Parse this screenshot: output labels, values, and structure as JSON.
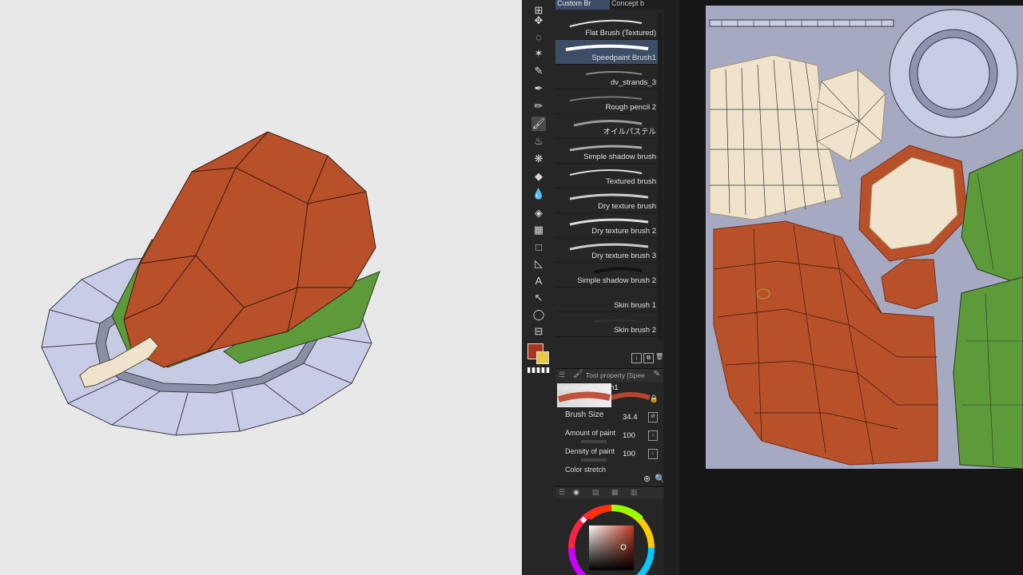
{
  "tabs": [
    {
      "label": "Custom Br",
      "selected": true
    },
    {
      "label": "Concept b",
      "selected": false
    }
  ],
  "brushes": [
    {
      "name": "Flat Brush (Textured)",
      "selected": false
    },
    {
      "name": "Speedpaint Brush1",
      "selected": true
    },
    {
      "name": "dv_strands_3",
      "selected": false
    },
    {
      "name": "Rough pencil 2",
      "selected": false
    },
    {
      "name": "オイルパステル",
      "selected": false
    },
    {
      "name": "Simple shadow brush",
      "selected": false
    },
    {
      "name": "Textured brush",
      "selected": false
    },
    {
      "name": "Dry texture brush",
      "selected": false
    },
    {
      "name": "Dry texture brush 2",
      "selected": false
    },
    {
      "name": "Dry texture brush 3",
      "selected": false
    },
    {
      "name": "Simple shadow brush 2",
      "selected": false
    },
    {
      "name": "Skin brush 1",
      "selected": false
    },
    {
      "name": "Skin brush 2",
      "selected": false
    }
  ],
  "tool_property": {
    "title": "Tool property [Spee",
    "preset_name": "Speedpaint Brush1",
    "brush_size": {
      "label": "Brush Size",
      "value": "34.4"
    },
    "amount_of_paint": {
      "label": "Amount of paint",
      "value": "100"
    },
    "density_of_paint": {
      "label": "Density of paint",
      "value": "100"
    },
    "color_stretch": {
      "label": "Color stretch"
    }
  },
  "colors": {
    "main": "#a8361f",
    "sub": "#e8c94a",
    "meat": "#b8502a",
    "leaf": "#5c9a3a",
    "plate": "#c3c8e2",
    "bone": "#efe4cb",
    "uv_bg": "#a6a9c2"
  },
  "ruler_ticks": [
    "80",
    "160",
    "240",
    "320",
    "400",
    "480",
    "560",
    "640",
    "720",
    "800",
    "880",
    "960",
    "1040",
    "1120",
    "1200"
  ],
  "tools": [
    "move-icon",
    "lasso-icon",
    "magic-wand-icon",
    "eyedropper-icon",
    "pen-icon",
    "pencil-icon",
    "brush-icon",
    "airbrush-icon",
    "decoration-icon",
    "eraser-icon",
    "blend-icon",
    "fill-icon",
    "gradient-icon",
    "figure-icon",
    "line-icon",
    "text-icon",
    "operation-icon",
    "balloon-icon",
    "frame-icon"
  ]
}
